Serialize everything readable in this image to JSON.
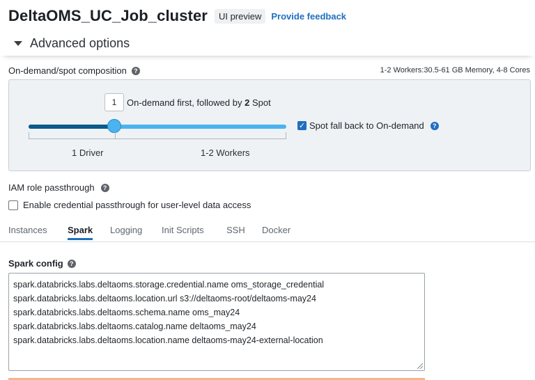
{
  "header": {
    "title": "DeltaOMS_UC_Job_cluster",
    "badge": "UI preview",
    "feedback_link": "Provide feedback"
  },
  "section": {
    "title": "Advanced options"
  },
  "composition": {
    "label": "On-demand/spot composition",
    "summary": "1-2 Workers:30.5-61 GB Memory, 4-8 Cores",
    "ondemand_count": "1",
    "desc_prefix": "On-demand first, followed by",
    "spot_count": "2",
    "desc_suffix": "Spot",
    "driver_label": "1 Driver",
    "workers_label": "1-2 Workers",
    "slider_value_fraction": 0.333,
    "spot_fallback_label": "Spot fall back to On-demand",
    "spot_fallback_checked": true
  },
  "iam": {
    "label": "IAM role passthrough",
    "checkbox_label": "Enable credential passthrough for user-level data access",
    "checked": false
  },
  "tabs": [
    {
      "label": "Instances",
      "active": false
    },
    {
      "label": "Spark",
      "active": true
    },
    {
      "label": "Logging",
      "active": false
    },
    {
      "label": "Init Scripts",
      "active": false
    },
    {
      "label": "SSH",
      "active": false
    },
    {
      "label": "Docker",
      "active": false
    }
  ],
  "spark_config": {
    "label": "Spark config",
    "lines": [
      "spark.databricks.labs.deltaoms.storage.credential.name oms_storage_credential",
      "spark.databricks.labs.deltaoms.location.url s3://deltaoms-root/deltaoms-may24",
      "spark.databricks.labs.deltaoms.schema.name oms_may24",
      "spark.databricks.labs.deltaoms.catalog.name deltaoms_may24",
      "spark.databricks.labs.deltaoms.location.name deltaoms-may24-external-location"
    ]
  },
  "icons": {
    "caret": "caret-down-icon",
    "help": "question-circle-icon",
    "check": "checkmark-icon"
  },
  "colors": {
    "accent": "#1f6fbf",
    "slider_dark": "#0a5a8a",
    "slider_light": "#4bb3ee"
  }
}
